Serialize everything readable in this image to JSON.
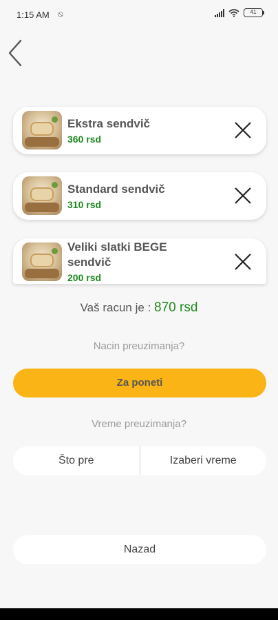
{
  "status_bar": {
    "time": "1:15 AM",
    "dnd": "⦸",
    "battery": "41"
  },
  "cart": {
    "items": [
      {
        "name": "Ekstra sendvič",
        "price": "360 rsd"
      },
      {
        "name": "Standard sendvič",
        "price": "310 rsd"
      },
      {
        "name": "Veliki slatki BEGE sendvič",
        "price": "200 rsd"
      }
    ]
  },
  "total": {
    "label": "Vaš racun je : ",
    "amount": "870 rsd"
  },
  "pickup_method": {
    "question": "Nacin preuzimanja?",
    "selected": "Za poneti"
  },
  "pickup_time": {
    "question": "Vreme preuzimanja?",
    "options": [
      "Što pre",
      "Izaberi vreme"
    ]
  },
  "back_button": {
    "label": "Nazad"
  },
  "colors": {
    "accent": "#fbb416",
    "price": "#1e8a1e",
    "background": "#f7f7f7"
  }
}
